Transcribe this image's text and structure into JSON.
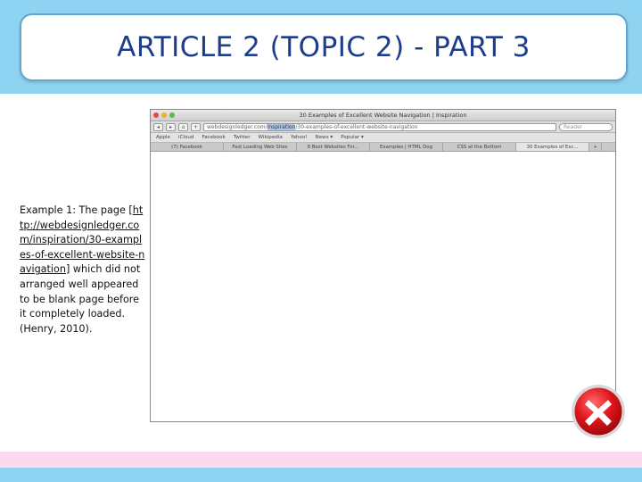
{
  "slide": {
    "title": "ARTICLE 2 (TOPIC 2) - PART 3",
    "caption": {
      "before": "Example 1: The page [",
      "link": "http://webdesignledger.com/inspiration/30-examples-of-excellent-website-navigation",
      "after": "] which did not arranged well appeared to be blank page before it completely loaded. (Henry, 2010)."
    }
  },
  "browser": {
    "window_title": "30 Examples of Excellent Website Navigation | Inspiration",
    "url_host": "webdesignledger.com/",
    "url_selected": "inspiration",
    "url_rest": "/30-examples-of-excellent-website-navigation",
    "search_placeholder": "Reader",
    "bookmarks": [
      "Apple",
      "iCloud",
      "Facebook",
      "Twitter",
      "Wikipedia",
      "Yahoo!",
      "News ▾",
      "Popular ▾"
    ],
    "tabs": [
      "(7) Facebook",
      "Fast Loading Web Sites",
      "8 Best Websites For...",
      "Examples | HTML Dog",
      "CSS at the Bottom",
      "30 Examples of Exc...",
      "+"
    ]
  },
  "icons": {
    "error": "red-x-icon",
    "error_color": "#e0141b"
  }
}
